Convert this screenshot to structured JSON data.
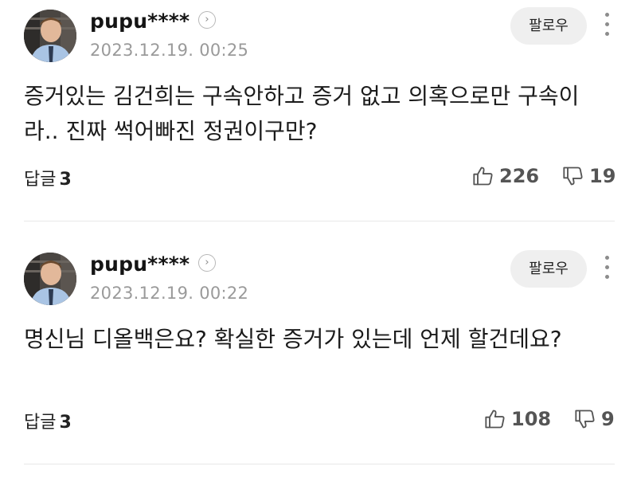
{
  "comments": [
    {
      "username": "pupu****",
      "timestamp": "2023.12.19. 00:25",
      "follow_label": "팔로우",
      "text": "증거있는 김건희는 구속안하고 증거 없고 의혹으로만 구속이라.. 진짜 썩어빠진 정권이구만?",
      "reply_label": "답글",
      "reply_count": "3",
      "likes": "226",
      "dislikes": "19"
    },
    {
      "username": "pupu****",
      "timestamp": "2023.12.19. 00:22",
      "follow_label": "팔로우",
      "text": "명신님 디올백은요? 확실한 증거가 있는데 언제 할건데요?",
      "reply_label": "답글",
      "reply_count": "3",
      "likes": "108",
      "dislikes": "9"
    }
  ],
  "icons": {
    "profile_arrow": "chevron-right-icon",
    "more": "vertical-dots-icon",
    "like": "thumbs-up-icon",
    "dislike": "thumbs-down-icon"
  }
}
